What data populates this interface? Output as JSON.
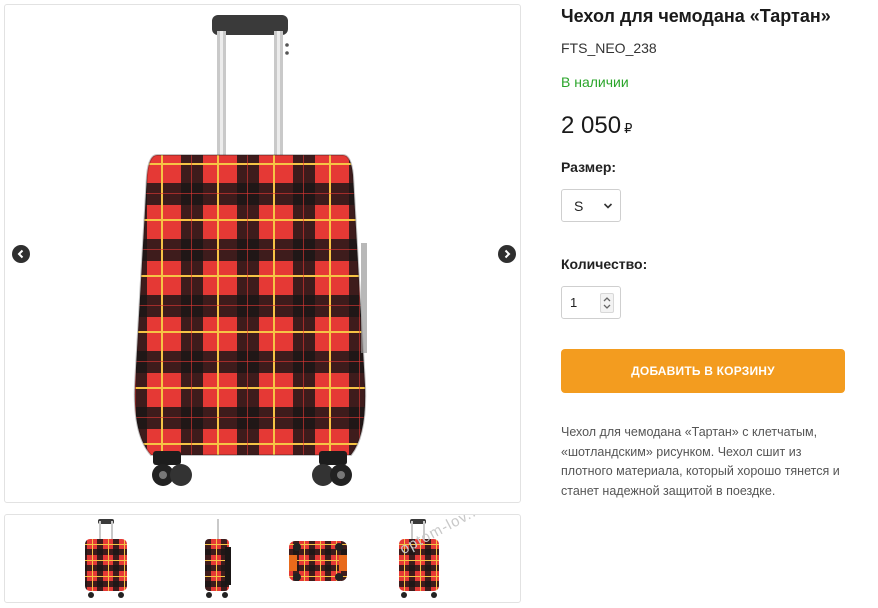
{
  "product": {
    "title": "Чехол для чемодана «Тартан»",
    "sku": "FTS_NEO_238",
    "availability": "В наличии",
    "price": "2 050",
    "currency": "₽",
    "size_label": "Размер:",
    "size_selected": "S",
    "quantity_label": "Количество:",
    "quantity_value": "1",
    "add_to_cart_label": "ДОБАВИТЬ В КОРЗИНУ",
    "description": "Чехол для чемодана «Тартан» с клетчатым, «шотландским» рисунком. Чехол сшит из плотного материала, который хорошо тянется и станет надежной защитой в поездке."
  },
  "gallery": {
    "prev_icon": "chevron-left-icon",
    "next_icon": "chevron-right-icon",
    "thumbnail_count": 4
  },
  "watermark": "optom-lov...",
  "colors": {
    "accent": "#f39c1f",
    "in_stock": "#2aa52a",
    "tartan_red": "#e53935",
    "tartan_dark": "#1a1616",
    "tartan_yellow": "#f6c445"
  }
}
